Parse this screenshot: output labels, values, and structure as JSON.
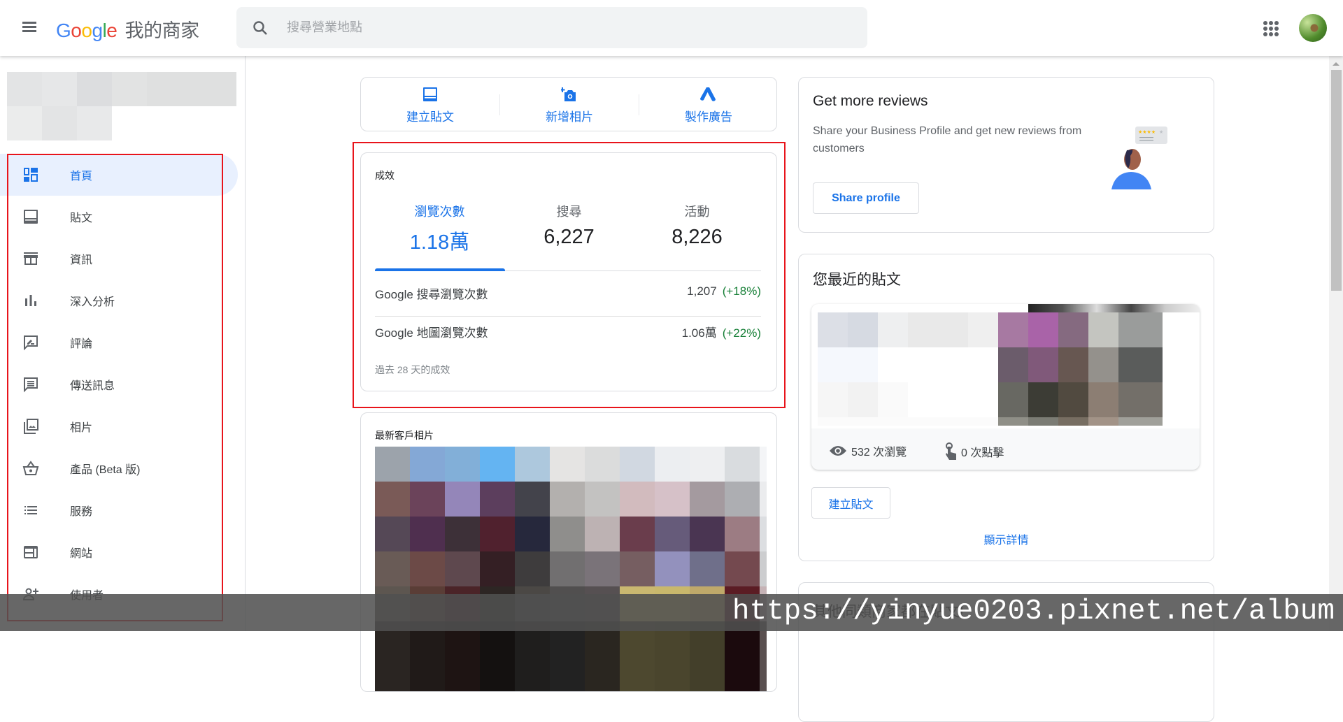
{
  "header": {
    "logo_letters": [
      "G",
      "o",
      "o",
      "g",
      "l",
      "e"
    ],
    "product_name": "我的商家",
    "search_placeholder": "搜尋營業地點",
    "icons": {
      "menu": "hamburger-menu-icon",
      "search": "search-icon",
      "apps": "apps-grid-icon",
      "avatar": "account-avatar"
    }
  },
  "sidebar": {
    "items": [
      {
        "label": "首頁",
        "icon": "dashboard-icon",
        "active": true
      },
      {
        "label": "貼文",
        "icon": "post-icon"
      },
      {
        "label": "資訊",
        "icon": "storefront-icon"
      },
      {
        "label": "深入分析",
        "icon": "bar-chart-icon"
      },
      {
        "label": "評論",
        "icon": "rate-review-icon"
      },
      {
        "label": "傳送訊息",
        "icon": "message-icon"
      },
      {
        "label": "相片",
        "icon": "photo-library-icon"
      },
      {
        "label": "產品 (Beta 版)",
        "icon": "basket-icon"
      },
      {
        "label": "服務",
        "icon": "list-icon"
      },
      {
        "label": "網站",
        "icon": "web-icon"
      },
      {
        "label": "使用者",
        "icon": "person-add-icon"
      }
    ]
  },
  "quick_actions": [
    {
      "label": "建立貼文",
      "icon": "post-icon"
    },
    {
      "label": "新增相片",
      "icon": "add-photo-icon"
    },
    {
      "label": "製作廣告",
      "icon": "google-ads-icon"
    }
  ],
  "performance": {
    "title": "成效",
    "tabs": [
      {
        "label": "瀏覽次數",
        "value": "1.18萬",
        "active": true
      },
      {
        "label": "搜尋",
        "value": "6,227"
      },
      {
        "label": "活動",
        "value": "8,226"
      }
    ],
    "rows": [
      {
        "label": "Google 搜尋瀏覽次數",
        "value": "1,207",
        "change": "(+18%)"
      },
      {
        "label": "Google 地圖瀏覽次數",
        "value": "1.06萬",
        "change": "(+22%)"
      }
    ],
    "footer": "過去 28 天的成效",
    "positive_color": "#188038"
  },
  "customer_photos": {
    "title": "最新客戶相片"
  },
  "reviews_card": {
    "title": "Get more reviews",
    "description": "Share your Business Profile and get new reviews from customers",
    "button": "Share profile"
  },
  "recent_posts": {
    "title": "您最近的貼文",
    "views": "532 次瀏覽",
    "clicks": "0 次點擊",
    "create_button": "建立貼文",
    "details_link": "顯示詳情"
  },
  "others_card": {
    "title": "其他同類商家都在貼文!"
  },
  "watermark": "https://yinyue0203.pixnet.net/album",
  "colors": {
    "accent": "#1a73e8",
    "active_bg": "#e8f0fe",
    "highlight_box": "#e8141b"
  }
}
